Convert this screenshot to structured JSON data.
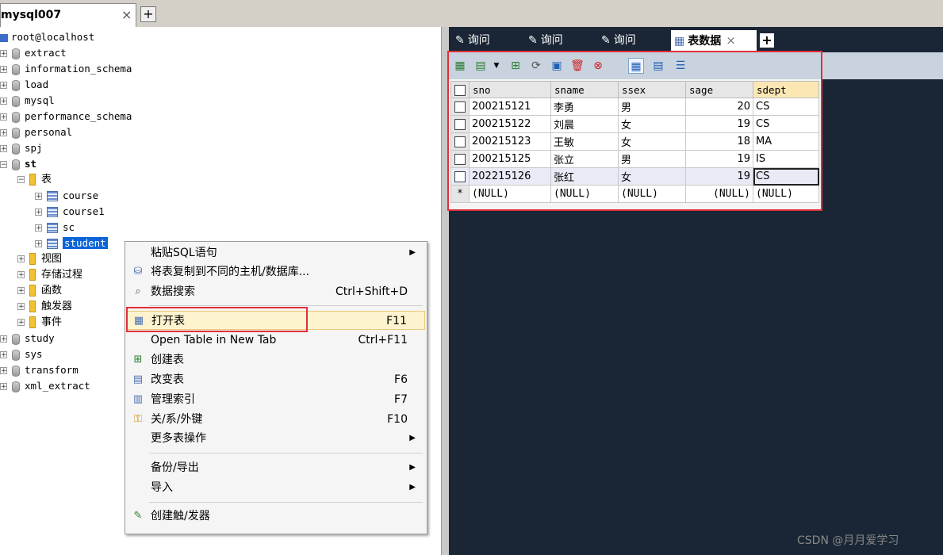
{
  "connection": {
    "tab_title": "mysql007",
    "close_glyph": "×",
    "add_glyph": "+"
  },
  "tree": {
    "host": "root@localhost",
    "databases": [
      "extract",
      "information_schema",
      "load",
      "mysql",
      "performance_schema",
      "personal",
      "spj"
    ],
    "open_db": "st",
    "st_folders": {
      "tables": "表"
    },
    "tables": [
      "course",
      "course1",
      "sc",
      "student"
    ],
    "other_folders": [
      "视图",
      "存储过程",
      "函数",
      "触发器",
      "事件"
    ],
    "databases_after": [
      "study",
      "sys",
      "transform",
      "xml_extract"
    ]
  },
  "query_tabs": [
    {
      "label": "询问",
      "icon": "query-icon"
    },
    {
      "label": "询问",
      "icon": "query-icon"
    },
    {
      "label": "询问",
      "icon": "query-icon"
    },
    {
      "label": "表数据",
      "icon": "table-data-icon",
      "active": true
    }
  ],
  "tab_close_glyph": "×",
  "tab_add_glyph": "+",
  "grid": {
    "columns": [
      "sno",
      "sname",
      "ssex",
      "sage",
      "sdept"
    ],
    "rows": [
      [
        "200215121",
        "李勇",
        "男",
        "20",
        "CS"
      ],
      [
        "200215122",
        "刘晨",
        "女",
        "19",
        "CS"
      ],
      [
        "200215123",
        "王敏",
        "女",
        "18",
        "MA"
      ],
      [
        "200215125",
        "张立",
        "男",
        "19",
        "IS"
      ],
      [
        "202215126",
        "张红",
        "女",
        "19",
        "CS"
      ]
    ],
    "new_row_marker": "*",
    "null_text": "(NULL)"
  },
  "context_menu": {
    "items": [
      {
        "label": "粘贴SQL语句",
        "shortcut": "",
        "submenu": true
      },
      {
        "label": "将表复制到不同的主机/数据库...",
        "shortcut": ""
      },
      {
        "label": "数据搜索",
        "shortcut": "Ctrl+Shift+D"
      },
      {
        "label": "打开表",
        "shortcut": "F11"
      },
      {
        "label": "Open Table in New Tab",
        "shortcut": "Ctrl+F11"
      },
      {
        "label": "创建表",
        "shortcut": ""
      },
      {
        "label": "改变表",
        "shortcut": "F6"
      },
      {
        "label": "管理索引",
        "shortcut": "F7"
      },
      {
        "label": "关/系/外键",
        "shortcut": "F10"
      },
      {
        "label": "更多表操作",
        "shortcut": "",
        "submenu": true
      },
      {
        "label": "备份/导出",
        "shortcut": "",
        "submenu": true
      },
      {
        "label": "导入",
        "shortcut": "",
        "submenu": true
      },
      {
        "label": "创建触/发器",
        "shortcut": ""
      }
    ],
    "submenu_arrow": "▶"
  },
  "watermark": "CSDN @月月爱学习"
}
